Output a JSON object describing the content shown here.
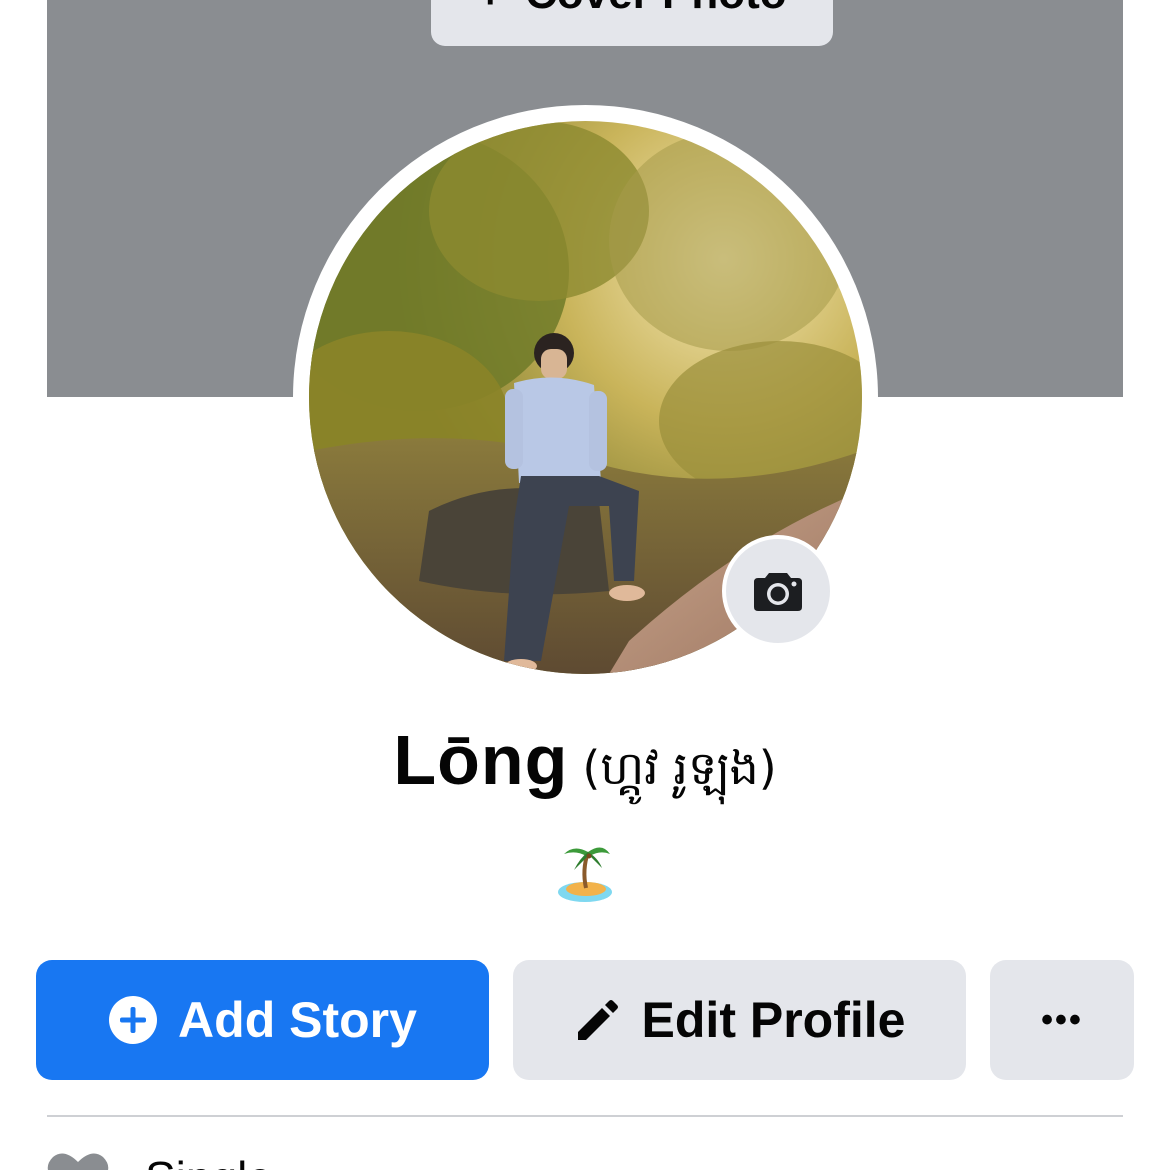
{
  "cover": {
    "button_icon": "+",
    "button_label": "Cover Photo"
  },
  "profile": {
    "name": "Lōng",
    "alternate_name": "(ហ្គូវ រូឡុង)",
    "bio_icon": "desert-island-icon"
  },
  "actions": {
    "add_story_label": "Add Story",
    "edit_profile_label": "Edit Profile",
    "more_label": "•••"
  },
  "details": {
    "relationship_icon": "heart-icon",
    "relationship_label": "Single"
  },
  "colors": {
    "primary": "#1877f2",
    "secondary_bg": "#e4e6eb",
    "cover_gray": "#8a8d91",
    "text": "#050505",
    "divider": "#ced0d4"
  }
}
